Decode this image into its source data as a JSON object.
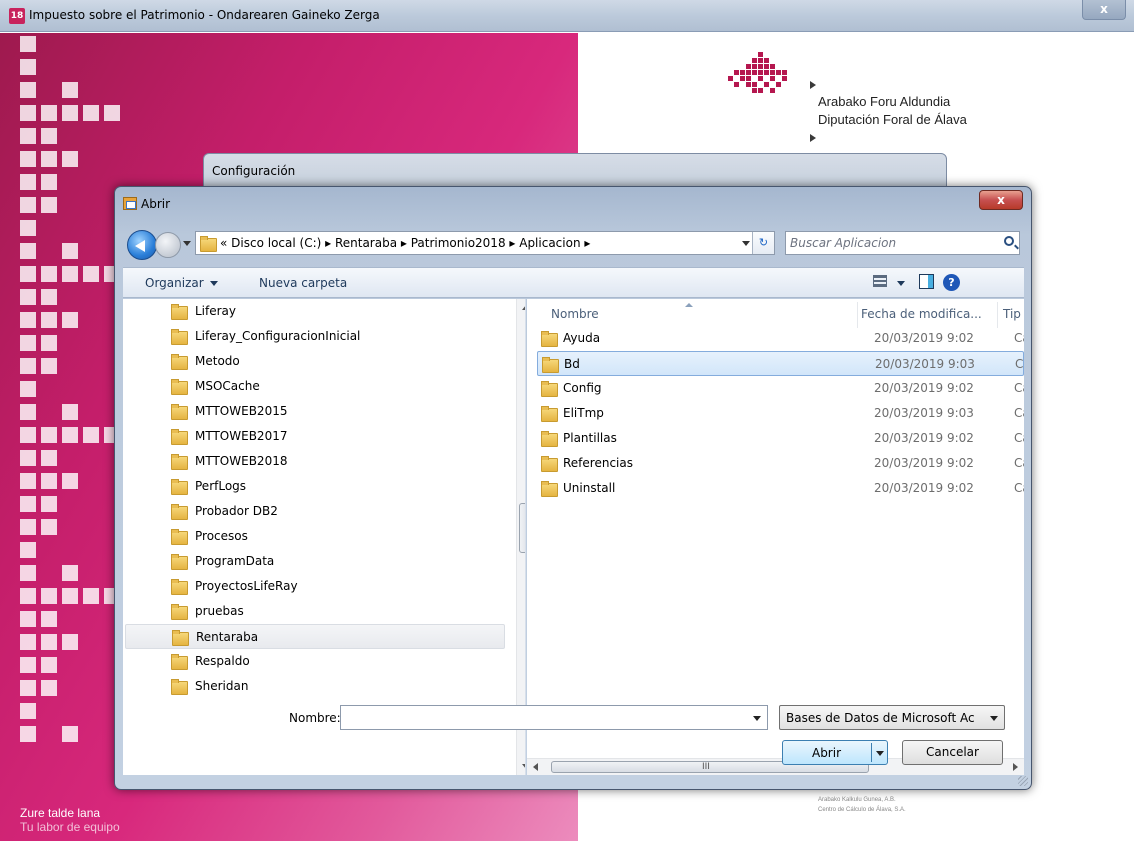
{
  "app": {
    "title": "Impuesto sobre el Patrimonio - Ondarearen Gaineko Zerga",
    "icon_text": "18",
    "close_label": "x",
    "slogan_line1": "Zure talde lana",
    "slogan_line2": "Tu labor de equipo",
    "logo_line1": "Arabako Foru Aldundia",
    "logo_line2": "Diputación Foral de Álava",
    "footer_line1": "Arabako Kalkulu Gunea, A.B.",
    "footer_line2": "Centro de Cálculo de Álava, S.A.",
    "brand_color": "#c41e6a"
  },
  "config_window": {
    "title": "Configuración"
  },
  "dialog": {
    "title": "Abrir",
    "close_label": "x",
    "address_path": "«  Disco local (C:)  ▸  Rentaraba  ▸  Patrimonio2018  ▸  Aplicacion  ▸",
    "search_placeholder": "Buscar Aplicacion",
    "toolbar": {
      "organize_label": "Organizar",
      "new_folder_label": "Nueva carpeta",
      "help_label": "?"
    },
    "tree": [
      {
        "label": "Liferay"
      },
      {
        "label": "Liferay_ConfiguracionInicial"
      },
      {
        "label": "Metodo"
      },
      {
        "label": "MSOCache"
      },
      {
        "label": "MTTOWEB2015"
      },
      {
        "label": "MTTOWEB2017"
      },
      {
        "label": "MTTOWEB2018"
      },
      {
        "label": "PerfLogs"
      },
      {
        "label": "Probador DB2"
      },
      {
        "label": "Procesos"
      },
      {
        "label": "ProgramData"
      },
      {
        "label": "ProyectosLifeRay"
      },
      {
        "label": "pruebas"
      },
      {
        "label": "Rentaraba",
        "selected": true
      },
      {
        "label": "Respaldo"
      },
      {
        "label": "Sheridan"
      }
    ],
    "columns": {
      "name": "Nombre",
      "date": "Fecha de modifica...",
      "type": "Tip"
    },
    "files": [
      {
        "name": "Ayuda",
        "date": "20/03/2019 9:02",
        "type": "Car"
      },
      {
        "name": "Bd",
        "date": "20/03/2019 9:03",
        "type": "Car",
        "selected": true
      },
      {
        "name": "Config",
        "date": "20/03/2019 9:02",
        "type": "Car"
      },
      {
        "name": "EliTmp",
        "date": "20/03/2019 9:03",
        "type": "Car"
      },
      {
        "name": "Plantillas",
        "date": "20/03/2019 9:02",
        "type": "Car"
      },
      {
        "name": "Referencias",
        "date": "20/03/2019 9:02",
        "type": "Car"
      },
      {
        "name": "Uninstall",
        "date": "20/03/2019 9:02",
        "type": "Car"
      }
    ],
    "hscroll_grip": "III",
    "filename_label": "Nombre:",
    "filename_value": "",
    "filetype_value": "Bases de Datos de Microsoft Ac",
    "open_label": "Abrir",
    "cancel_label": "Cancelar"
  }
}
